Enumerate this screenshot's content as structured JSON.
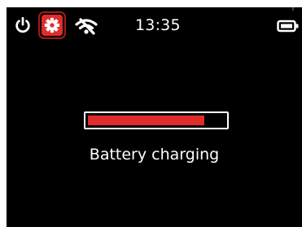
{
  "status_bar": {
    "time": "13:35",
    "icons": {
      "power": "power-icon",
      "settings": "gear-icon",
      "wifi": "wifi-off-icon",
      "battery": "battery-icon"
    }
  },
  "battery": {
    "status_text": "Battery charging",
    "charge_level": 0.85,
    "fill_color": "#e02c2c"
  },
  "colors": {
    "background": "#000000",
    "accent": "#e02c2c",
    "text": "#ffffff"
  }
}
